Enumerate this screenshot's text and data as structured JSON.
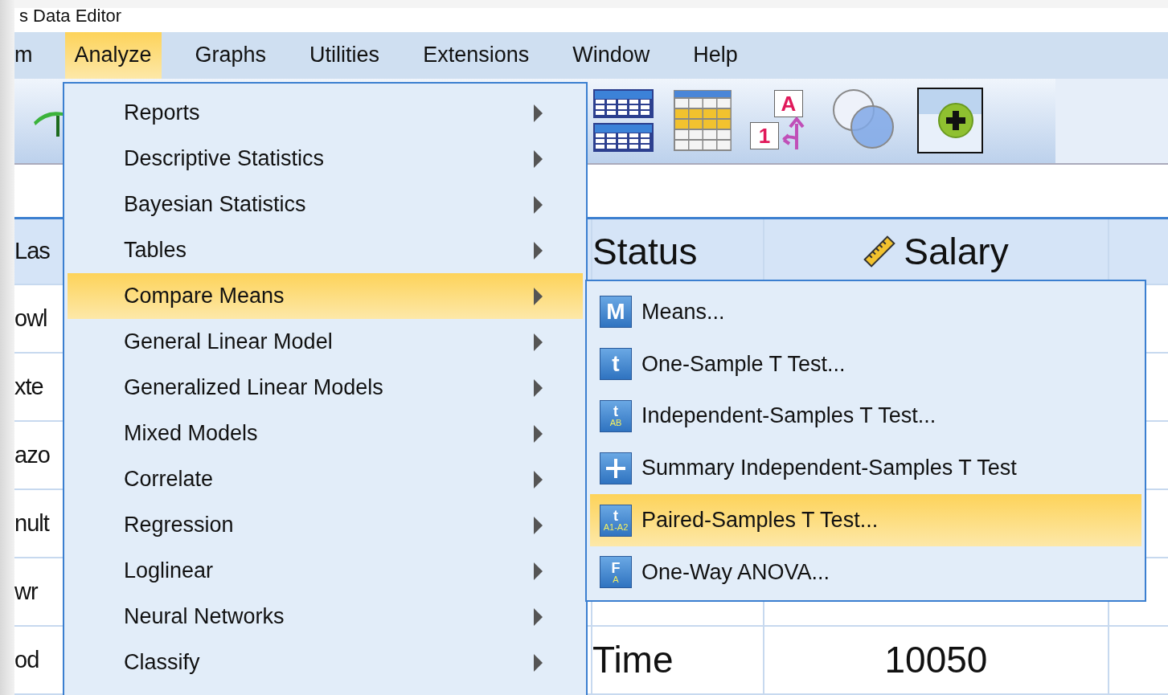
{
  "window": {
    "title": "s Data Editor"
  },
  "menubar": [
    {
      "label": "m",
      "selected": false
    },
    {
      "label": "Analyze",
      "selected": true
    },
    {
      "label": "Graphs",
      "selected": false
    },
    {
      "label": "Utilities",
      "selected": false
    },
    {
      "label": "Extensions",
      "selected": false
    },
    {
      "label": "Window",
      "selected": false
    },
    {
      "label": "Help",
      "selected": false
    }
  ],
  "toolbar": [
    {
      "kind": "arc"
    },
    {
      "kind": "split-table"
    },
    {
      "kind": "grid-table"
    },
    {
      "kind": "value-labels",
      "labels": [
        "A",
        "1"
      ]
    },
    {
      "kind": "circles"
    },
    {
      "kind": "add-button"
    }
  ],
  "grid": {
    "columns": [
      {
        "label": "Las"
      },
      {
        "label": "Status"
      },
      {
        "label": "Salary",
        "kind": "scale"
      }
    ],
    "rows": [
      {
        "col_1": "owl"
      },
      {
        "col_1": "xte"
      },
      {
        "col_1": "azo"
      },
      {
        "col_1": "nult"
      },
      {
        "col_1": "wr"
      },
      {
        "col_1": "od",
        "status": "Time",
        "salary": "10050"
      }
    ]
  },
  "analyze_menu": [
    {
      "label": "Reports",
      "selected": false
    },
    {
      "label": "Descriptive Statistics",
      "selected": false
    },
    {
      "label": "Bayesian Statistics",
      "selected": false
    },
    {
      "label": "Tables",
      "selected": false
    },
    {
      "label": "Compare Means",
      "selected": true
    },
    {
      "label": "General Linear Model",
      "selected": false
    },
    {
      "label": "Generalized Linear Models",
      "selected": false
    },
    {
      "label": "Mixed Models",
      "selected": false
    },
    {
      "label": "Correlate",
      "selected": false
    },
    {
      "label": "Regression",
      "selected": false
    },
    {
      "label": "Loglinear",
      "selected": false
    },
    {
      "label": "Neural Networks",
      "selected": false
    },
    {
      "label": "Classify",
      "selected": false
    }
  ],
  "compare_means_menu": [
    {
      "label": "Means...",
      "selected": false,
      "icon": {
        "kind": "letter",
        "main": "M"
      }
    },
    {
      "label": "One-Sample T Test...",
      "selected": false,
      "icon": {
        "kind": "letter",
        "main": "t"
      }
    },
    {
      "label": "Independent-Samples T Test...",
      "selected": false,
      "icon": {
        "kind": "letter",
        "main": "t",
        "sub": "AB"
      }
    },
    {
      "label": "Summary Independent-Samples T Test",
      "selected": false,
      "icon": {
        "kind": "plus"
      }
    },
    {
      "label": "Paired-Samples T Test...",
      "selected": true,
      "icon": {
        "kind": "letter",
        "main": "t",
        "sub": "A1-A2"
      }
    },
    {
      "label": "One-Way ANOVA...",
      "selected": false,
      "icon": {
        "kind": "letter",
        "main": "F",
        "sub": "A"
      }
    }
  ]
}
